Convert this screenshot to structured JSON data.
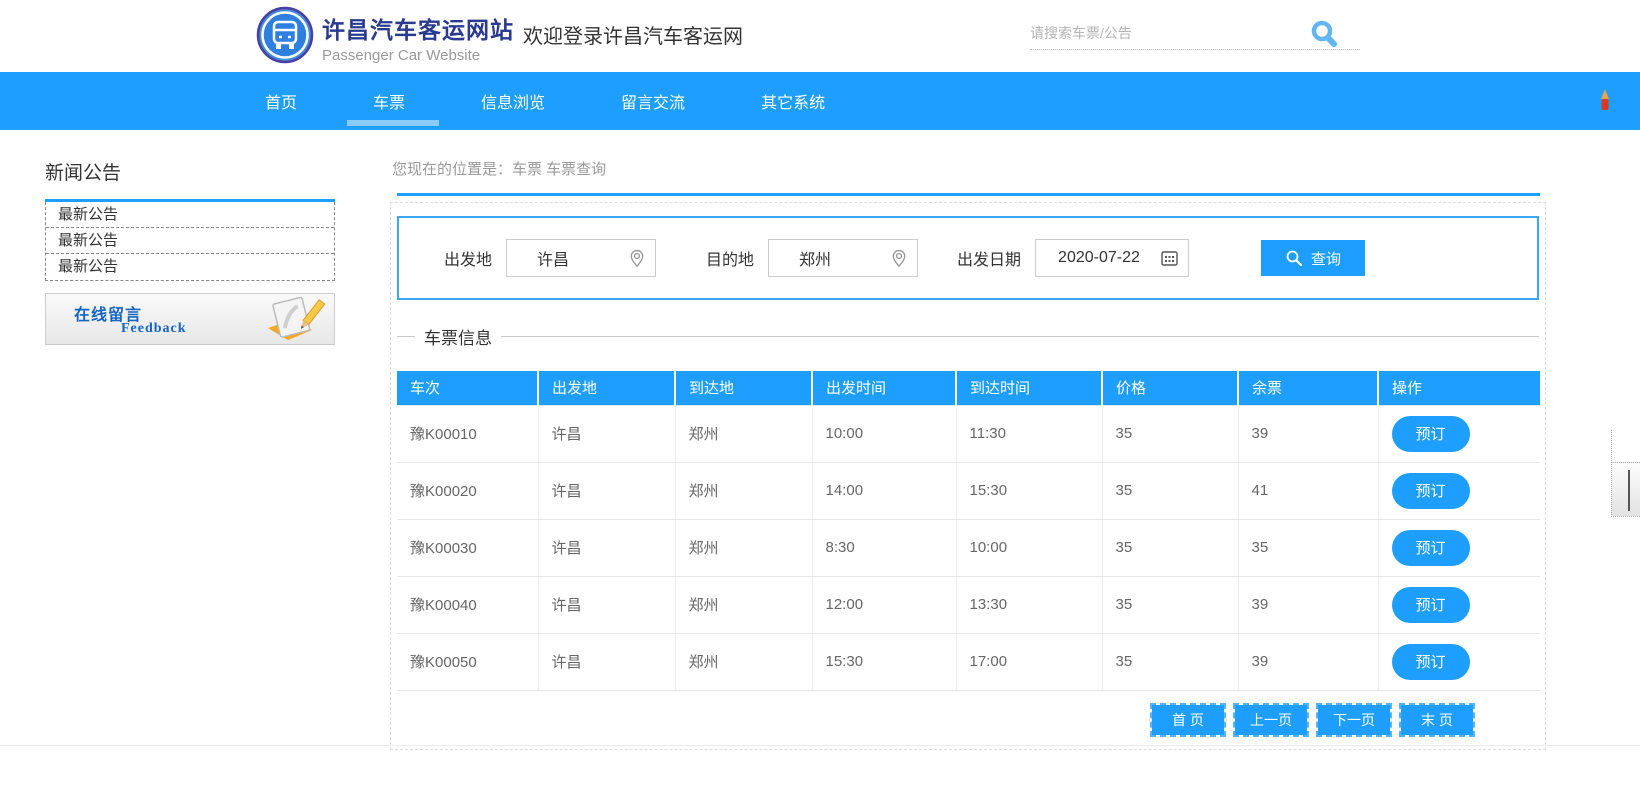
{
  "header": {
    "logo_title": "许昌汽车客运网站",
    "logo_subtitle": "Passenger Car Website",
    "welcome": "欢迎登录许昌汽车客运网",
    "search_placeholder": "请搜索车票/公告"
  },
  "nav": {
    "items": [
      {
        "label": "首页",
        "active": false
      },
      {
        "label": "车票",
        "active": true
      },
      {
        "label": "信息浏览",
        "active": false
      },
      {
        "label": "留言交流",
        "active": false
      },
      {
        "label": "其它系统",
        "active": false
      }
    ]
  },
  "sidebar": {
    "news_title": "新闻公告",
    "news_items": [
      "最新公告",
      "最新公告",
      "最新公告"
    ],
    "feedback_title": "在线留言",
    "feedback_subtitle": "Feedback"
  },
  "main": {
    "breadcrumb": "您现在的位置是：车票 车票查询",
    "form": {
      "from_label": "出发地",
      "from_value": "许昌",
      "to_label": "目的地",
      "to_value": "郑州",
      "date_label": "出发日期",
      "date_value": "2020-07-22",
      "search_button": "查询"
    },
    "section_title": "车票信息",
    "table": {
      "headers": [
        "车次",
        "出发地",
        "到达地",
        "出发时间",
        "到达时间",
        "价格",
        "余票",
        "操作"
      ],
      "rows": [
        {
          "train": "豫K00010",
          "from": "许昌",
          "to": "郑州",
          "depart": "10:00",
          "arrive": "11:30",
          "price": "35",
          "remain": "39",
          "action": "预订"
        },
        {
          "train": "豫K00020",
          "from": "许昌",
          "to": "郑州",
          "depart": "14:00",
          "arrive": "15:30",
          "price": "35",
          "remain": "41",
          "action": "预订"
        },
        {
          "train": "豫K00030",
          "from": "许昌",
          "to": "郑州",
          "depart": "8:30",
          "arrive": "10:00",
          "price": "35",
          "remain": "35",
          "action": "预订"
        },
        {
          "train": "豫K00040",
          "from": "许昌",
          "to": "郑州",
          "depart": "12:00",
          "arrive": "13:30",
          "price": "35",
          "remain": "39",
          "action": "预订"
        },
        {
          "train": "豫K00050",
          "from": "许昌",
          "to": "郑州",
          "depart": "15:30",
          "arrive": "17:00",
          "price": "35",
          "remain": "39",
          "action": "预订"
        }
      ]
    },
    "pagination": [
      "首 页",
      "上一页",
      "下一页",
      "末 页"
    ]
  },
  "icons": {
    "logo": "bus",
    "header_search": "magnifier",
    "location": "map-pin",
    "date": "calendar-grid",
    "query_button": "magnifier",
    "feedback": "notepad-pencil",
    "nav_right": "pencil"
  },
  "colors": {
    "primary": "#1E9FFF",
    "active_tab_underline": "#8BCBF7",
    "logo_title": "#2A3B8F",
    "feedback_text": "#1565C0",
    "body_text": "#666666"
  }
}
